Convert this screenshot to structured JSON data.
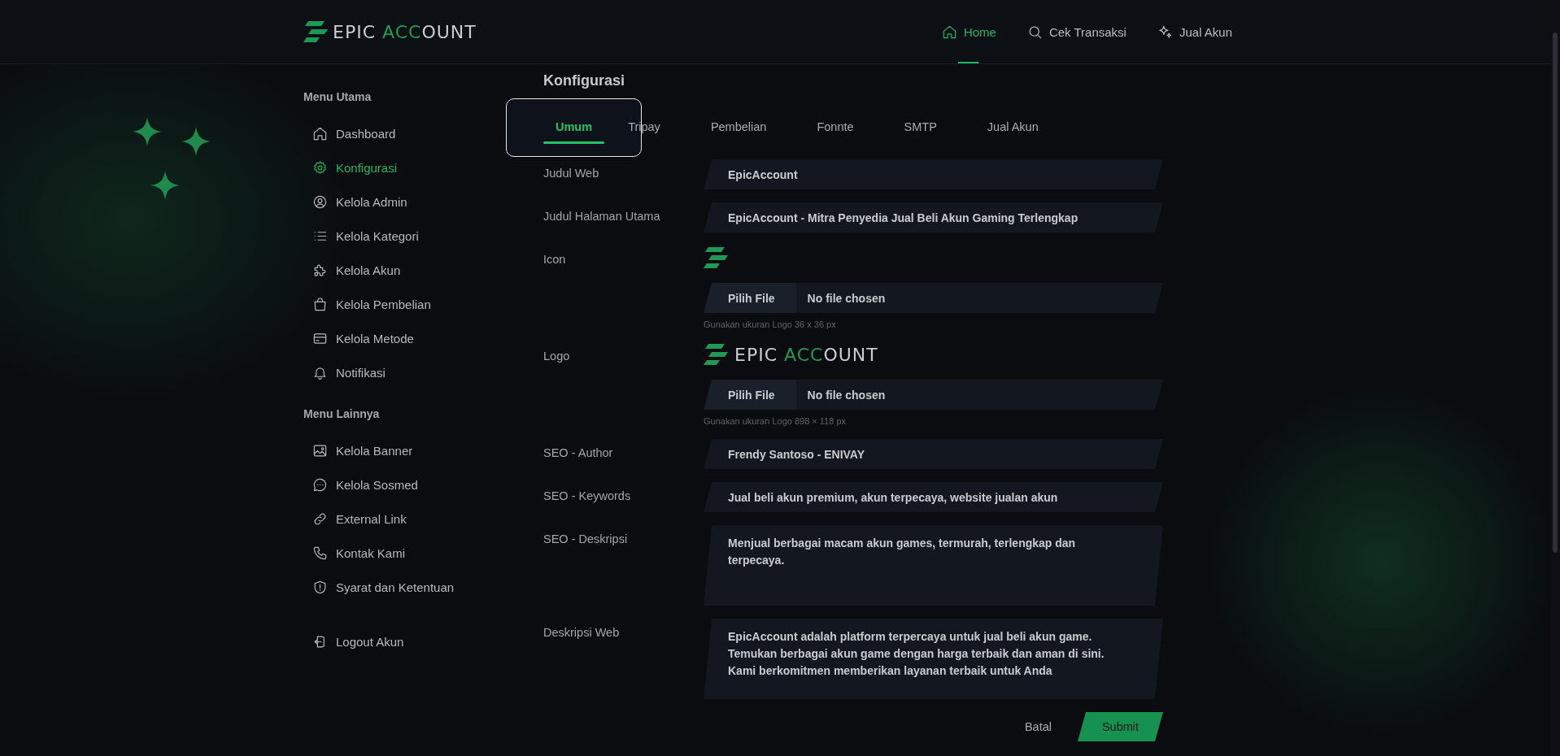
{
  "header": {
    "logo": [
      "EPIC ",
      "ACC",
      "OUNT"
    ],
    "nav": [
      {
        "label": "Home",
        "selected": true
      },
      {
        "label": "Cek Transaksi",
        "selected": false
      },
      {
        "label": "Jual Akun",
        "selected": false
      }
    ]
  },
  "sidebar": {
    "sections": [
      {
        "title": "Menu Utama",
        "items": [
          {
            "label": "Dashboard",
            "selected": false
          },
          {
            "label": "Konfigurasi",
            "selected": true
          },
          {
            "label": "Kelola Admin",
            "selected": false
          },
          {
            "label": "Kelola Kategori",
            "selected": false
          },
          {
            "label": "Kelola Akun",
            "selected": false
          },
          {
            "label": "Kelola Pembelian",
            "selected": false
          },
          {
            "label": "Kelola Metode",
            "selected": false
          },
          {
            "label": "Notifikasi",
            "selected": false
          }
        ]
      },
      {
        "title": "Menu Lainnya",
        "items": [
          {
            "label": "Kelola Banner",
            "selected": false
          },
          {
            "label": "Kelola Sosmed",
            "selected": false
          },
          {
            "label": "External Link",
            "selected": false
          },
          {
            "label": "Kontak Kami",
            "selected": false
          },
          {
            "label": "Syarat dan Ketentuan",
            "selected": false
          }
        ]
      }
    ],
    "logout": {
      "label": "Logout Akun"
    }
  },
  "page": {
    "title": "Konfigurasi",
    "tabs": [
      {
        "label": "Umum",
        "selected": true
      },
      {
        "label": "Tripay",
        "selected": false
      },
      {
        "label": "Pembelian",
        "selected": false
      },
      {
        "label": "Fonnte",
        "selected": false
      },
      {
        "label": "SMTP",
        "selected": false
      },
      {
        "label": "Jual Akun",
        "selected": false
      }
    ],
    "fields": [
      {
        "kind": "text",
        "label": "Judul Web",
        "value": "EpicAccount"
      },
      {
        "kind": "text",
        "label": "Judul Halaman Utama",
        "value": "EpicAccount - Mitra Penyedia Jual Beli Akun Gaming Terlengkap"
      },
      {
        "kind": "icon-upload",
        "label": "Icon",
        "button": "Pilih File",
        "file_status": "No file chosen",
        "hint": "Gunakan ukuran Logo 36 x 36 px"
      },
      {
        "kind": "logo-upload",
        "label": "Logo",
        "logo": [
          "EPIC ",
          "ACC",
          "OUNT"
        ],
        "button": "Pilih File",
        "file_status": "No file chosen",
        "hint": "Gunakan ukuran Logo 898 × 118 px"
      },
      {
        "kind": "text",
        "label": "SEO - Author",
        "value": "Frendy Santoso - ENIVAY"
      },
      {
        "kind": "text",
        "label": "SEO - Keywords",
        "value": "Jual beli akun premium, akun terpecaya, website jualan akun"
      },
      {
        "kind": "textarea",
        "label": "SEO - Deskripsi",
        "value": "Menjual berbagai macam akun games, termurah, terlengkap dan terpecaya."
      },
      {
        "kind": "textarea",
        "label": "Deskripsi Web",
        "value": "EpicAccount adalah platform terpercaya untuk jual beli akun game. Temukan berbagai akun game dengan harga terbaik dan aman di sini. Kami berkomitmen memberikan layanan terbaik untuk Anda"
      }
    ],
    "cancel": "Batal",
    "submit": "Submit"
  }
}
